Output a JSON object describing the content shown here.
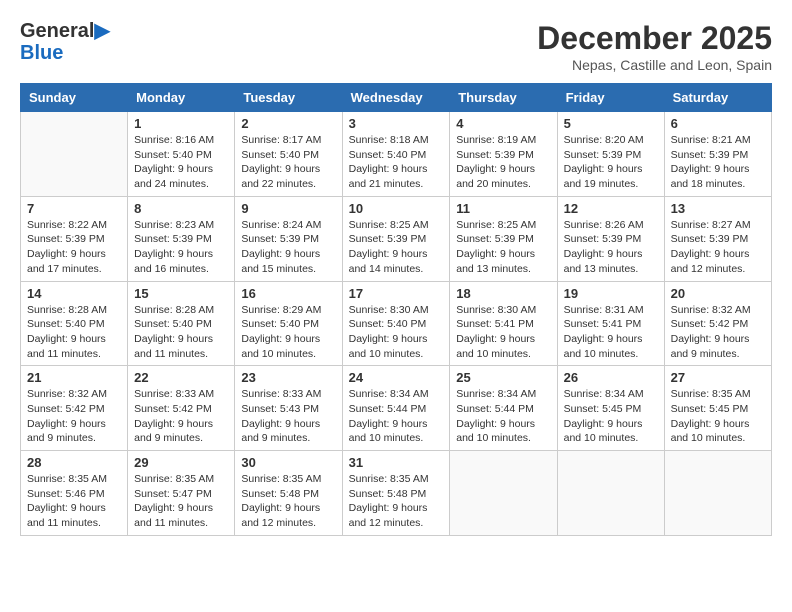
{
  "logo": {
    "general": "General",
    "blue": "Blue"
  },
  "title": "December 2025",
  "location": "Nepas, Castille and Leon, Spain",
  "days_of_week": [
    "Sunday",
    "Monday",
    "Tuesday",
    "Wednesday",
    "Thursday",
    "Friday",
    "Saturday"
  ],
  "weeks": [
    [
      {
        "day": "",
        "info": ""
      },
      {
        "day": "1",
        "info": "Sunrise: 8:16 AM\nSunset: 5:40 PM\nDaylight: 9 hours\nand 24 minutes."
      },
      {
        "day": "2",
        "info": "Sunrise: 8:17 AM\nSunset: 5:40 PM\nDaylight: 9 hours\nand 22 minutes."
      },
      {
        "day": "3",
        "info": "Sunrise: 8:18 AM\nSunset: 5:40 PM\nDaylight: 9 hours\nand 21 minutes."
      },
      {
        "day": "4",
        "info": "Sunrise: 8:19 AM\nSunset: 5:39 PM\nDaylight: 9 hours\nand 20 minutes."
      },
      {
        "day": "5",
        "info": "Sunrise: 8:20 AM\nSunset: 5:39 PM\nDaylight: 9 hours\nand 19 minutes."
      },
      {
        "day": "6",
        "info": "Sunrise: 8:21 AM\nSunset: 5:39 PM\nDaylight: 9 hours\nand 18 minutes."
      }
    ],
    [
      {
        "day": "7",
        "info": "Sunrise: 8:22 AM\nSunset: 5:39 PM\nDaylight: 9 hours\nand 17 minutes."
      },
      {
        "day": "8",
        "info": "Sunrise: 8:23 AM\nSunset: 5:39 PM\nDaylight: 9 hours\nand 16 minutes."
      },
      {
        "day": "9",
        "info": "Sunrise: 8:24 AM\nSunset: 5:39 PM\nDaylight: 9 hours\nand 15 minutes."
      },
      {
        "day": "10",
        "info": "Sunrise: 8:25 AM\nSunset: 5:39 PM\nDaylight: 9 hours\nand 14 minutes."
      },
      {
        "day": "11",
        "info": "Sunrise: 8:25 AM\nSunset: 5:39 PM\nDaylight: 9 hours\nand 13 minutes."
      },
      {
        "day": "12",
        "info": "Sunrise: 8:26 AM\nSunset: 5:39 PM\nDaylight: 9 hours\nand 13 minutes."
      },
      {
        "day": "13",
        "info": "Sunrise: 8:27 AM\nSunset: 5:39 PM\nDaylight: 9 hours\nand 12 minutes."
      }
    ],
    [
      {
        "day": "14",
        "info": "Sunrise: 8:28 AM\nSunset: 5:40 PM\nDaylight: 9 hours\nand 11 minutes."
      },
      {
        "day": "15",
        "info": "Sunrise: 8:28 AM\nSunset: 5:40 PM\nDaylight: 9 hours\nand 11 minutes."
      },
      {
        "day": "16",
        "info": "Sunrise: 8:29 AM\nSunset: 5:40 PM\nDaylight: 9 hours\nand 10 minutes."
      },
      {
        "day": "17",
        "info": "Sunrise: 8:30 AM\nSunset: 5:40 PM\nDaylight: 9 hours\nand 10 minutes."
      },
      {
        "day": "18",
        "info": "Sunrise: 8:30 AM\nSunset: 5:41 PM\nDaylight: 9 hours\nand 10 minutes."
      },
      {
        "day": "19",
        "info": "Sunrise: 8:31 AM\nSunset: 5:41 PM\nDaylight: 9 hours\nand 10 minutes."
      },
      {
        "day": "20",
        "info": "Sunrise: 8:32 AM\nSunset: 5:42 PM\nDaylight: 9 hours\nand 9 minutes."
      }
    ],
    [
      {
        "day": "21",
        "info": "Sunrise: 8:32 AM\nSunset: 5:42 PM\nDaylight: 9 hours\nand 9 minutes."
      },
      {
        "day": "22",
        "info": "Sunrise: 8:33 AM\nSunset: 5:42 PM\nDaylight: 9 hours\nand 9 minutes."
      },
      {
        "day": "23",
        "info": "Sunrise: 8:33 AM\nSunset: 5:43 PM\nDaylight: 9 hours\nand 9 minutes."
      },
      {
        "day": "24",
        "info": "Sunrise: 8:34 AM\nSunset: 5:44 PM\nDaylight: 9 hours\nand 10 minutes."
      },
      {
        "day": "25",
        "info": "Sunrise: 8:34 AM\nSunset: 5:44 PM\nDaylight: 9 hours\nand 10 minutes."
      },
      {
        "day": "26",
        "info": "Sunrise: 8:34 AM\nSunset: 5:45 PM\nDaylight: 9 hours\nand 10 minutes."
      },
      {
        "day": "27",
        "info": "Sunrise: 8:35 AM\nSunset: 5:45 PM\nDaylight: 9 hours\nand 10 minutes."
      }
    ],
    [
      {
        "day": "28",
        "info": "Sunrise: 8:35 AM\nSunset: 5:46 PM\nDaylight: 9 hours\nand 11 minutes."
      },
      {
        "day": "29",
        "info": "Sunrise: 8:35 AM\nSunset: 5:47 PM\nDaylight: 9 hours\nand 11 minutes."
      },
      {
        "day": "30",
        "info": "Sunrise: 8:35 AM\nSunset: 5:48 PM\nDaylight: 9 hours\nand 12 minutes."
      },
      {
        "day": "31",
        "info": "Sunrise: 8:35 AM\nSunset: 5:48 PM\nDaylight: 9 hours\nand 12 minutes."
      },
      {
        "day": "",
        "info": ""
      },
      {
        "day": "",
        "info": ""
      },
      {
        "day": "",
        "info": ""
      }
    ]
  ]
}
